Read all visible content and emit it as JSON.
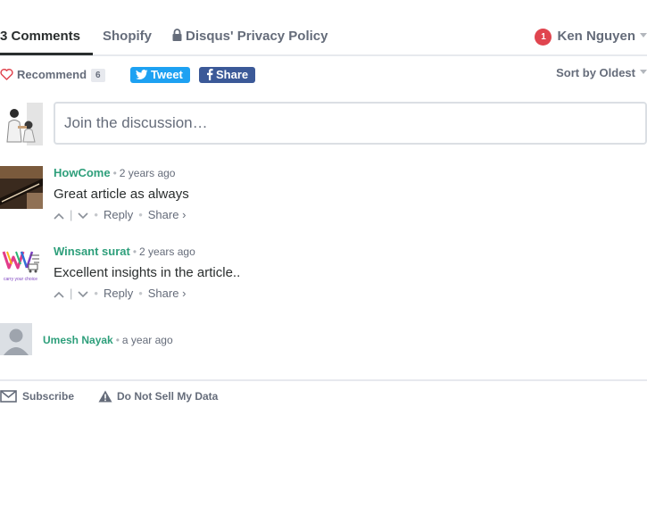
{
  "nav": {
    "tabs": [
      {
        "label": "3 Comments"
      },
      {
        "label": "Shopify"
      },
      {
        "label": "Disqus' Privacy Policy"
      }
    ],
    "notifications": "1",
    "user_name": "Ken Nguyen"
  },
  "toolbar": {
    "recommend_label": "Recommend",
    "recommend_count": "6",
    "tweet_label": "Tweet",
    "share_label": "Share",
    "sort_label": "Sort by Oldest"
  },
  "composer": {
    "placeholder": "Join the discussion…"
  },
  "comments": [
    {
      "author": "HowCome",
      "time": "2 years ago",
      "text": "Great article as always",
      "reply": "Reply",
      "share": "Share ›"
    },
    {
      "author": "Winsant surat",
      "time": "2 years ago",
      "text": "Excellent insights in the article..",
      "reply": "Reply",
      "share": "Share ›",
      "logo_text": "carry your choice"
    },
    {
      "author": "Umesh Nayak",
      "time": "a year ago"
    }
  ],
  "footer": {
    "subscribe": "Subscribe",
    "do_not_sell": "Do Not Sell My Data"
  },
  "colors": {
    "author": "#2e9f7b",
    "tweet": "#1da1f2",
    "facebook": "#3b5998",
    "notification": "#e0454f",
    "heart": "#e0454f"
  },
  "icons": [
    "lock-icon",
    "heart-icon",
    "twitter-icon",
    "facebook-icon",
    "upvote-icon",
    "downvote-icon",
    "envelope-icon",
    "warning-icon",
    "caret-down-icon"
  ]
}
